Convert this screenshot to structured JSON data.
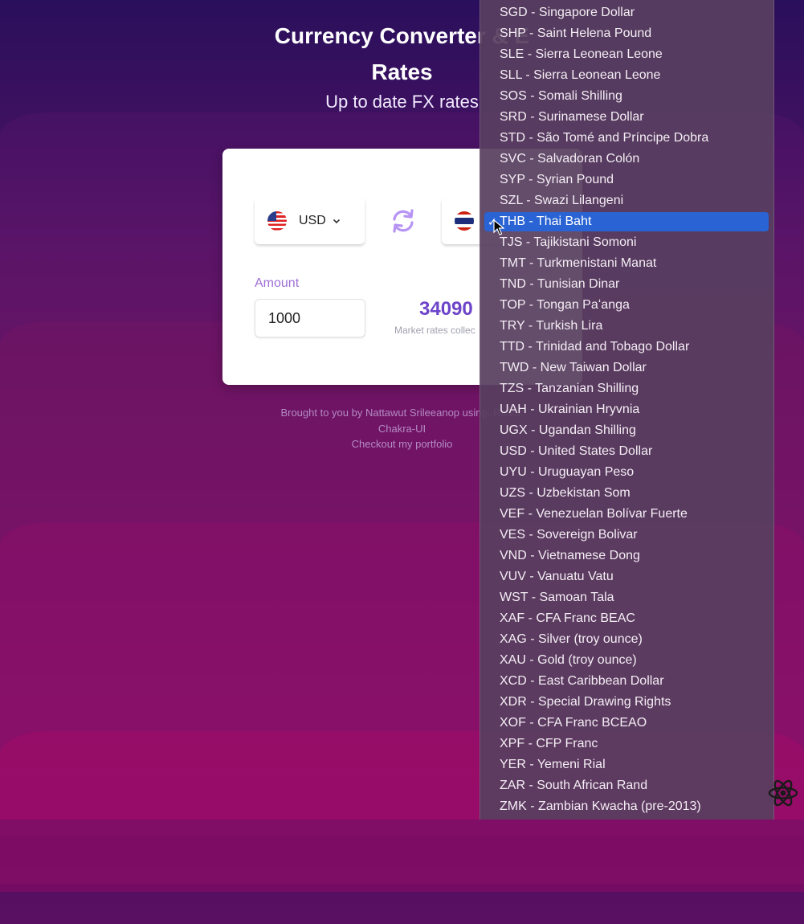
{
  "header": {
    "title_line1": "Currency Converter & E",
    "title_line2": "Rates",
    "subtitle": "Up to date FX rates"
  },
  "converter": {
    "from_currency": "USD",
    "from_flag": "us-flag-icon",
    "to_flag": "thailand-flag-icon",
    "swap_icon": "swap-arrows-icon",
    "amount_label": "Amount",
    "amount_value": "1000",
    "result": "34090",
    "note": "Market rates collec"
  },
  "footer": {
    "line1": "Brought to you by Nattawut Srileeanop using: React,",
    "line2": "Chakra-UI",
    "line3": "Checkout my portfolio"
  },
  "dropdown": {
    "selected_index": 10,
    "check_mark": "✓",
    "options": [
      "SGD - Singapore Dollar",
      "SHP - Saint Helena Pound",
      "SLE - Sierra Leonean Leone",
      "SLL - Sierra Leonean Leone",
      "SOS - Somali Shilling",
      "SRD - Surinamese Dollar",
      "STD - São Tomé and Príncipe Dobra",
      "SVC - Salvadoran Colón",
      "SYP - Syrian Pound",
      "SZL - Swazi Lilangeni",
      "THB - Thai Baht",
      "TJS - Tajikistani Somoni",
      "TMT - Turkmenistani Manat",
      "TND - Tunisian Dinar",
      "TOP - Tongan Paʻanga",
      "TRY - Turkish Lira",
      "TTD - Trinidad and Tobago Dollar",
      "TWD - New Taiwan Dollar",
      "TZS - Tanzanian Shilling",
      "UAH - Ukrainian Hryvnia",
      "UGX - Ugandan Shilling",
      "USD - United States Dollar",
      "UYU - Uruguayan Peso",
      "UZS - Uzbekistan Som",
      "VEF - Venezuelan Bolívar Fuerte",
      "VES - Sovereign Bolivar",
      "VND - Vietnamese Dong",
      "VUV - Vanuatu Vatu",
      "WST - Samoan Tala",
      "XAF - CFA Franc BEAC",
      "XAG - Silver (troy ounce)",
      "XAU - Gold (troy ounce)",
      "XCD - East Caribbean Dollar",
      "XDR - Special Drawing Rights",
      "XOF - CFA Franc BCEAO",
      "XPF - CFP Franc",
      "YER - Yemeni Rial",
      "ZAR - South African Rand",
      "ZMK - Zambian Kwacha (pre-2013)"
    ]
  },
  "overlay_icons": {
    "cursor": "mouse-cursor-icon",
    "devtools": "react-devtools-icon"
  }
}
